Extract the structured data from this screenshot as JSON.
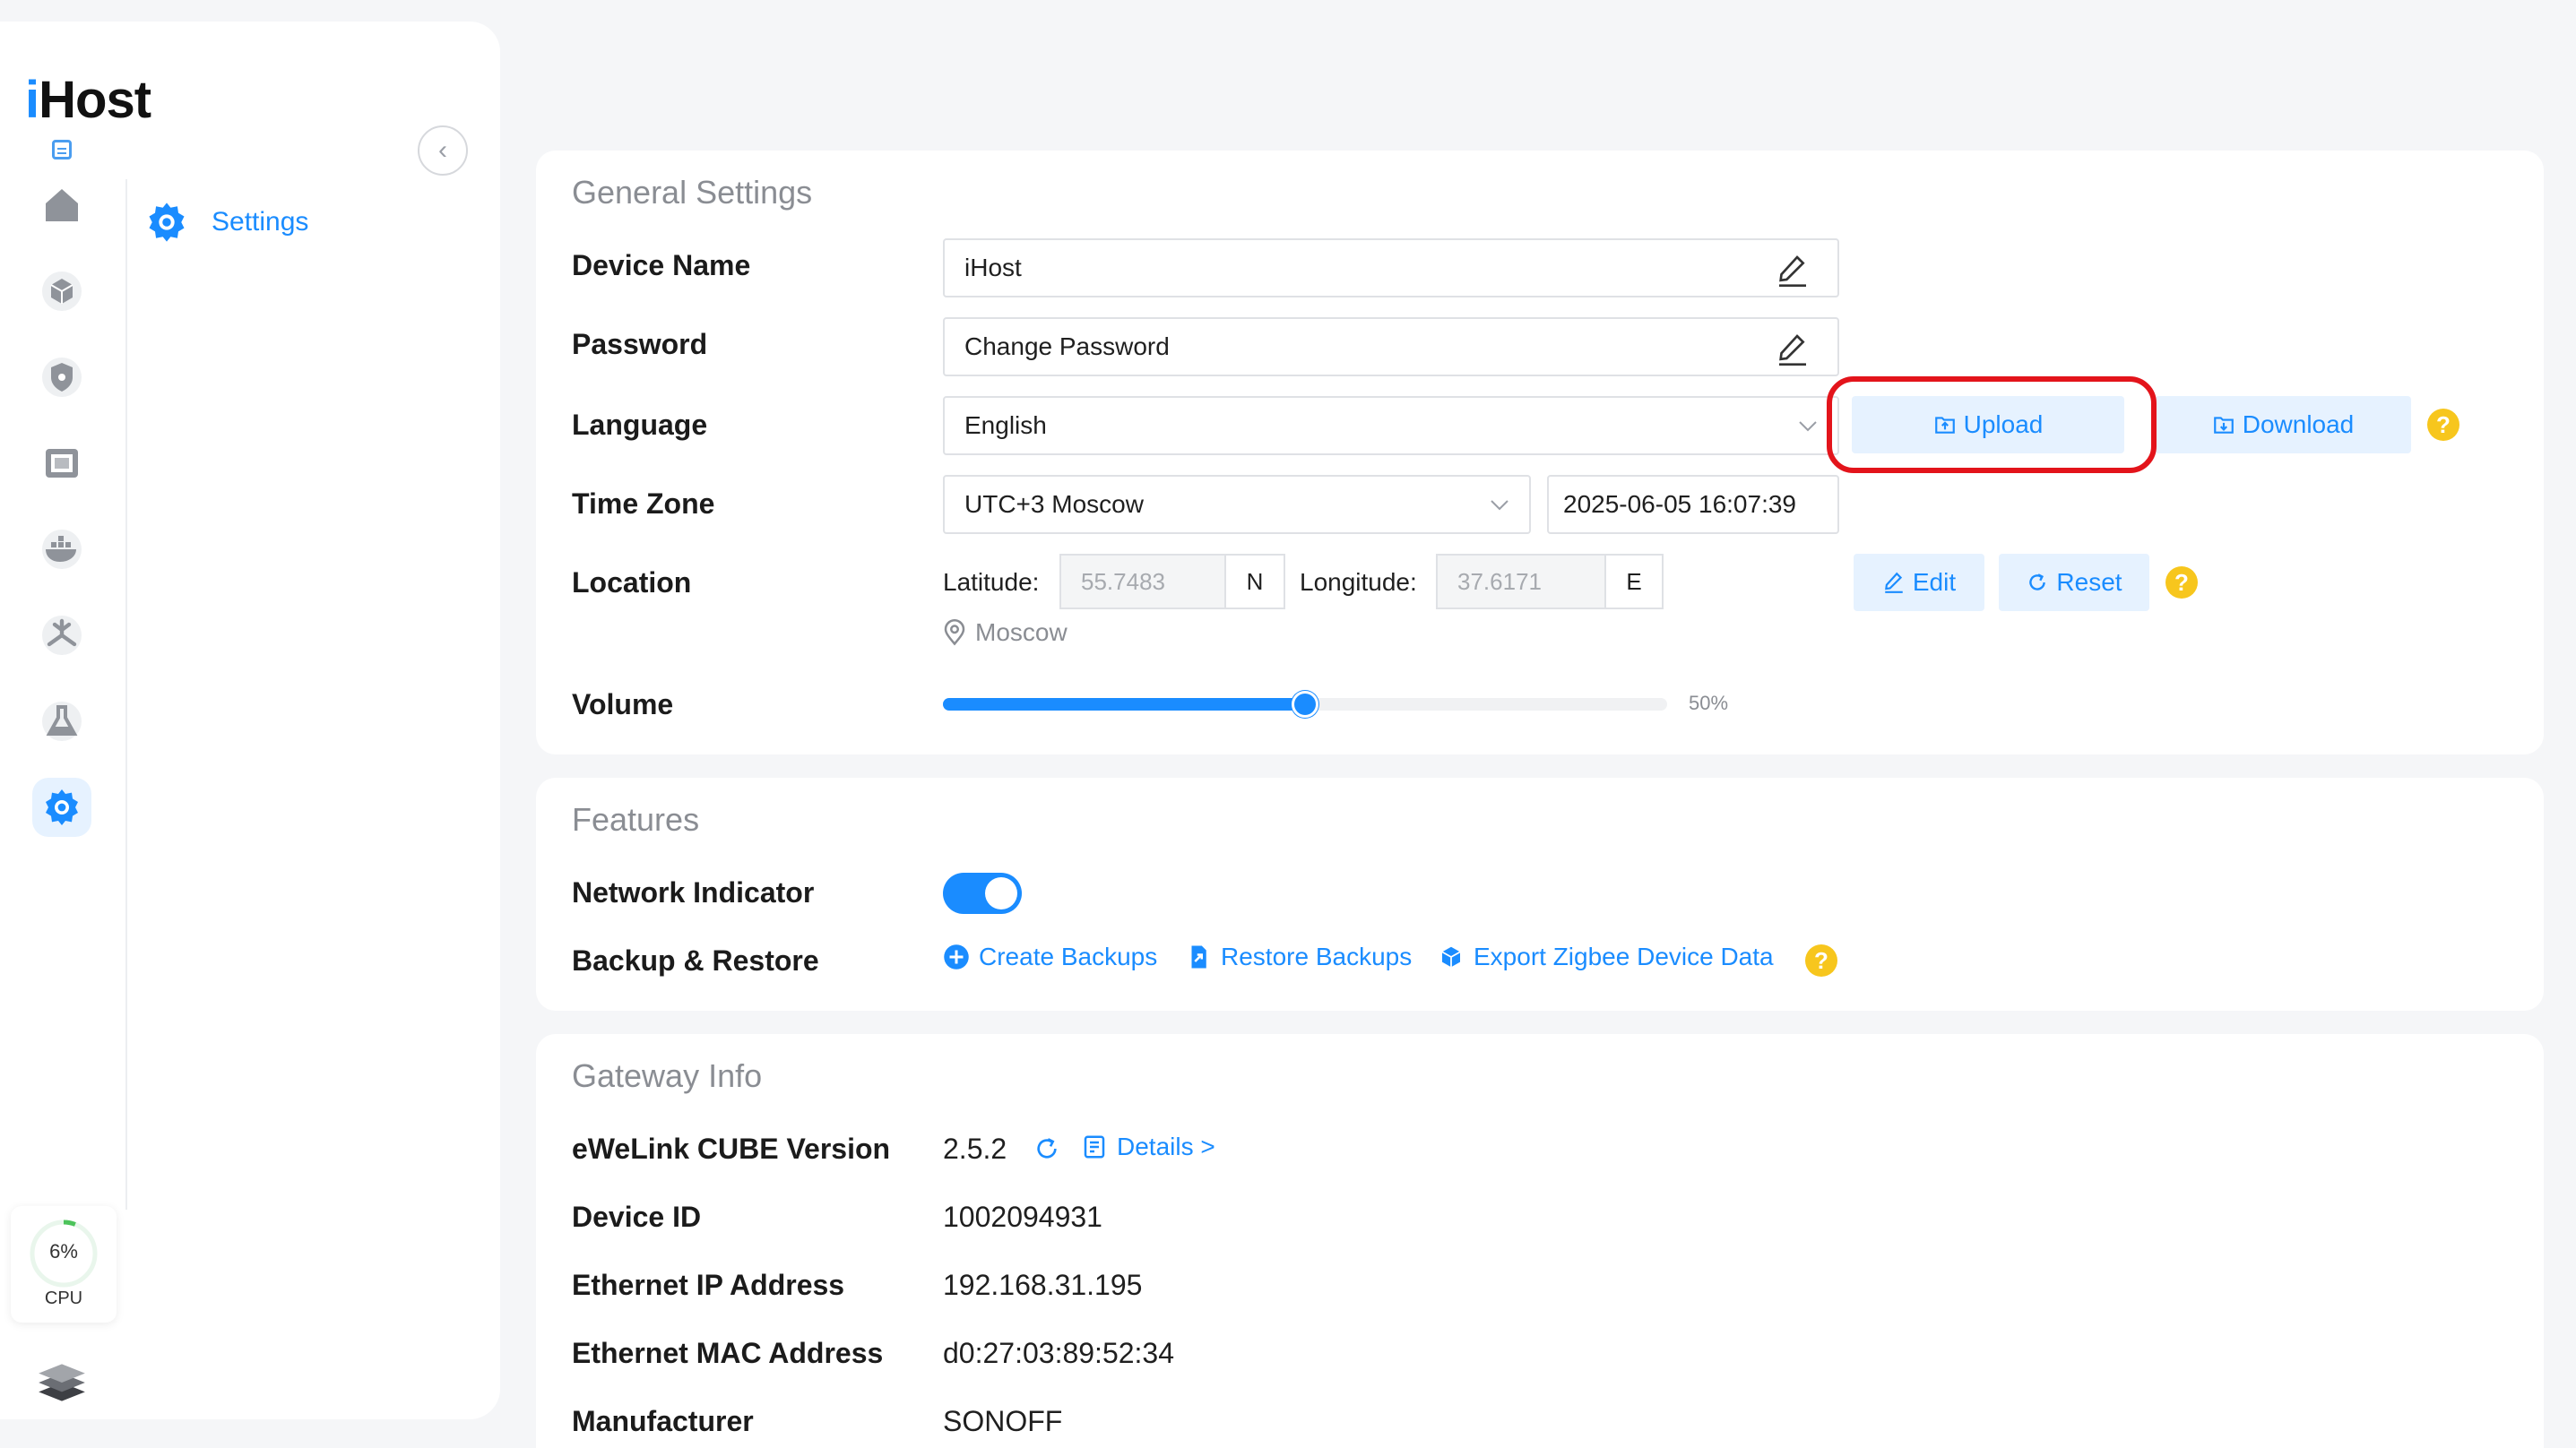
{
  "sidebar": {
    "logo_prefix": "i",
    "logo_rest": "Host",
    "collapse_glyph": "‹",
    "nav": [
      {
        "icon": "home-icon"
      },
      {
        "icon": "cube-icon"
      },
      {
        "icon": "shield-icon"
      },
      {
        "icon": "display-icon"
      },
      {
        "icon": "docker-icon"
      },
      {
        "icon": "automation-icon"
      },
      {
        "icon": "lab-icon"
      },
      {
        "icon": "gear-icon",
        "active": true
      }
    ],
    "settings_label": "Settings",
    "cpu": {
      "value": "6%",
      "label": "CPU",
      "fraction": 0.06
    }
  },
  "general": {
    "title": "General Settings",
    "device_name": {
      "label": "Device Name",
      "value": "iHost"
    },
    "password": {
      "label": "Password",
      "value": "Change Password"
    },
    "language": {
      "label": "Language",
      "value": "English",
      "upload": "Upload",
      "download": "Download"
    },
    "timezone": {
      "label": "Time Zone",
      "value": "UTC+3 Moscow",
      "datetime": "2025-06-05 16:07:39"
    },
    "location": {
      "label": "Location",
      "lat_label": "Latitude:",
      "lat_value": "55.7483",
      "lat_unit": "N",
      "lon_label": "Longitude:",
      "lon_value": "37.6171",
      "lon_unit": "E",
      "edit": "Edit",
      "reset": "Reset",
      "city": "Moscow"
    },
    "volume": {
      "label": "Volume",
      "value_text": "50%",
      "fraction": 0.5
    },
    "help_glyph": "?"
  },
  "features": {
    "title": "Features",
    "network_indicator": {
      "label": "Network Indicator",
      "on": true
    },
    "backup": {
      "label": "Backup & Restore",
      "create": "Create Backups",
      "restore": "Restore Backups",
      "export": "Export Zigbee Device Data"
    }
  },
  "gateway": {
    "title": "Gateway Info",
    "version": {
      "label": "eWeLink CUBE Version",
      "value": "2.5.2",
      "details": "Details >"
    },
    "device_id": {
      "label": "Device ID",
      "value": "1002094931"
    },
    "ip": {
      "label": "Ethernet IP Address",
      "value": "192.168.31.195"
    },
    "mac": {
      "label": "Ethernet MAC Address",
      "value": "d0:27:03:89:52:34"
    },
    "manufacturer": {
      "label": "Manufacturer",
      "value": "SONOFF"
    }
  },
  "colors": {
    "accent": "#1a8cff",
    "highlight": "#e3141b",
    "help": "#f7c61d"
  }
}
